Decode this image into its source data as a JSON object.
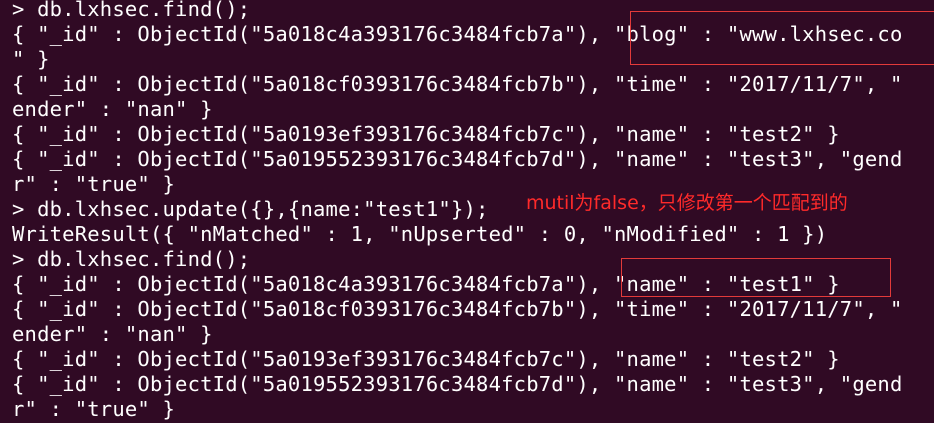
{
  "terminal": {
    "lines": [
      "> db.lxhsec.find();",
      "{ \"_id\" : ObjectId(\"5a018c4a393176c3484fcb7a\"), \"blog\" : \"www.lxhsec.co",
      "\" }",
      "{ \"_id\" : ObjectId(\"5a018cf0393176c3484fcb7b\"), \"time\" : \"2017/11/7\", \"",
      "ender\" : \"nan\" }",
      "{ \"_id\" : ObjectId(\"5a0193ef393176c3484fcb7c\"), \"name\" : \"test2\" }",
      "{ \"_id\" : ObjectId(\"5a019552393176c3484fcb7d\"), \"name\" : \"test3\", \"gend",
      "r\" : \"true\" }",
      "> db.lxhsec.update({},{name:\"test1\"});",
      "WriteResult({ \"nMatched\" : 1, \"nUpserted\" : 0, \"nModified\" : 1 })",
      "> db.lxhsec.find();",
      "{ \"_id\" : ObjectId(\"5a018c4a393176c3484fcb7a\"), \"name\" : \"test1\" }",
      "{ \"_id\" : ObjectId(\"5a018cf0393176c3484fcb7b\"), \"time\" : \"2017/11/7\", \"",
      "ender\" : \"nan\" }",
      "{ \"_id\" : ObjectId(\"5a0193ef393176c3484fcb7c\"), \"name\" : \"test2\" }",
      "{ \"_id\" : ObjectId(\"5a019552393176c3484fcb7d\"), \"name\" : \"test3\", \"gend",
      "r\" : \"true\" }"
    ],
    "annotation": "mutil为false，只修改第一个匹配到的",
    "colors": {
      "background": "#300a24",
      "text": "#ffffff",
      "highlight": "#e33a3a",
      "annotation": "#ff2a2a"
    }
  }
}
